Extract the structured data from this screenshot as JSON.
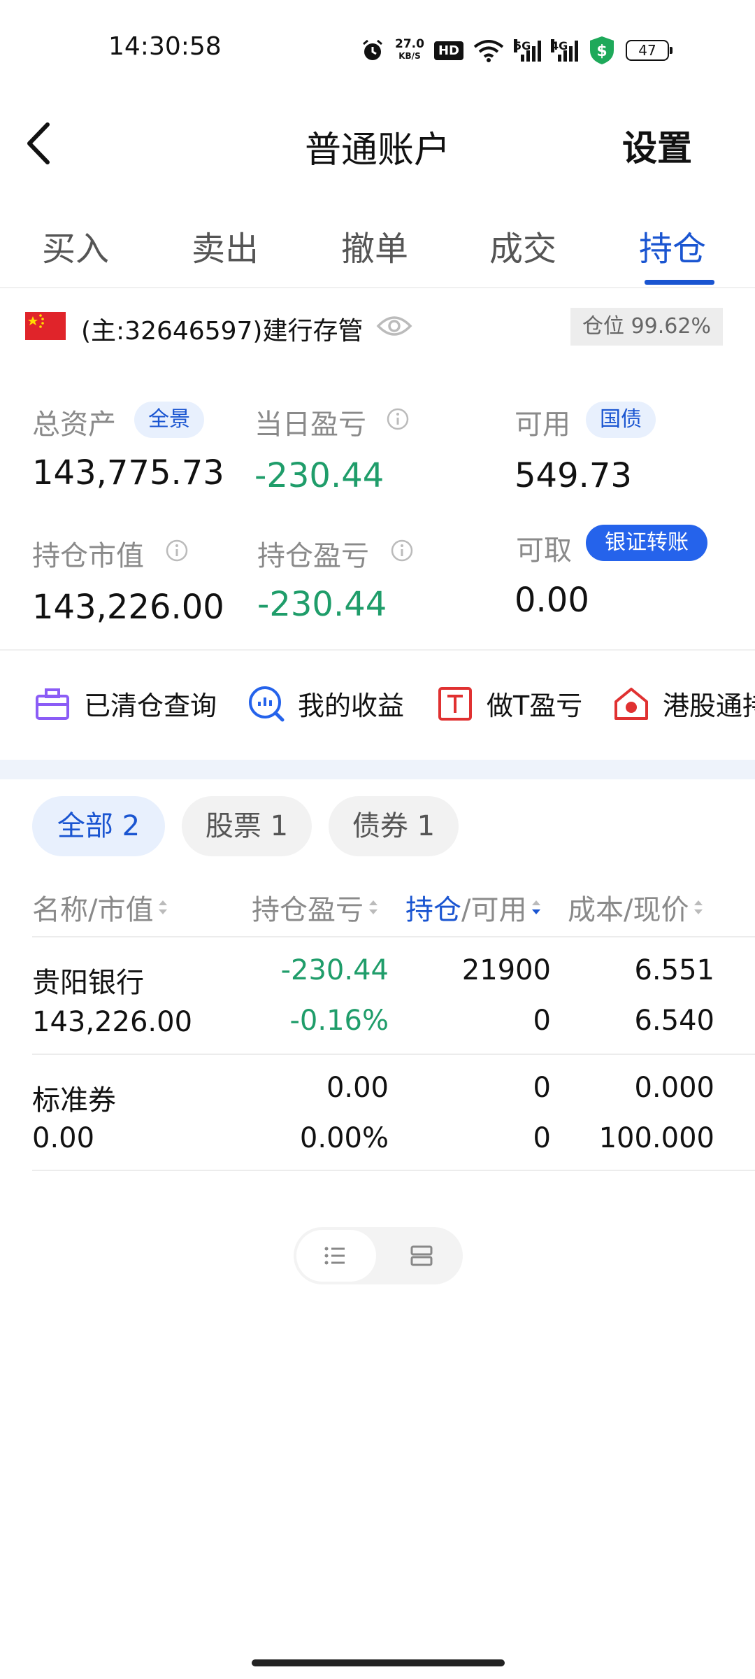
{
  "status_bar": {
    "time": "14:30:58",
    "net_speed_value": "27.0",
    "net_speed_unit": "KB/S",
    "hd_label": "HD",
    "sig1_label": "5G",
    "sig2_label": "4G",
    "battery": "47"
  },
  "nav": {
    "title": "普通账户",
    "settings": "设置"
  },
  "tabs": [
    {
      "label": "买入"
    },
    {
      "label": "卖出"
    },
    {
      "label": "撤单"
    },
    {
      "label": "成交"
    },
    {
      "label": "持仓"
    }
  ],
  "account": {
    "name": "(主:32646597)建行存管",
    "position_ratio": "仓位 99.62%"
  },
  "assets": {
    "total_label": "总资产",
    "total_tag": "全景",
    "total_value": "143,775.73",
    "daily_pl_label": "当日盈亏",
    "daily_pl_value": "-230.44",
    "available_label": "可用",
    "available_tag": "国债",
    "available_value": "549.73",
    "market_value_label": "持仓市值",
    "market_value": "143,226.00",
    "position_pl_label": "持仓盈亏",
    "position_pl_value": "-230.44",
    "withdrawable_label": "可取",
    "withdrawable_tag": "银证转账",
    "withdrawable_value": "0.00"
  },
  "tools": [
    {
      "label": "已清仓查询"
    },
    {
      "label": "我的收益"
    },
    {
      "label": "做T盈亏"
    },
    {
      "label": "港股通持"
    }
  ],
  "filters": [
    {
      "label": "全部 2"
    },
    {
      "label": "股票 1"
    },
    {
      "label": "债券 1"
    }
  ],
  "table": {
    "headers": {
      "name": "名称/市值",
      "pl": "持仓盈亏",
      "pos_a": "持仓",
      "pos_b": "/可用",
      "cost": "成本/现价"
    },
    "rows": [
      {
        "name": "贵阳银行",
        "market_value": "143,226.00",
        "pl": "-230.44",
        "pl_pct": "-0.16%",
        "position": "21900",
        "available": "0",
        "cost": "6.551",
        "price": "6.540"
      },
      {
        "name": "标准券",
        "market_value": "0.00",
        "pl": "0.00",
        "pl_pct": "0.00%",
        "position": "0",
        "available": "0",
        "cost": "0.000",
        "price": "100.000"
      }
    ]
  },
  "colors": {
    "accent": "#1a55d1",
    "loss": "#1f9d6a",
    "flag": "#e0242a"
  }
}
